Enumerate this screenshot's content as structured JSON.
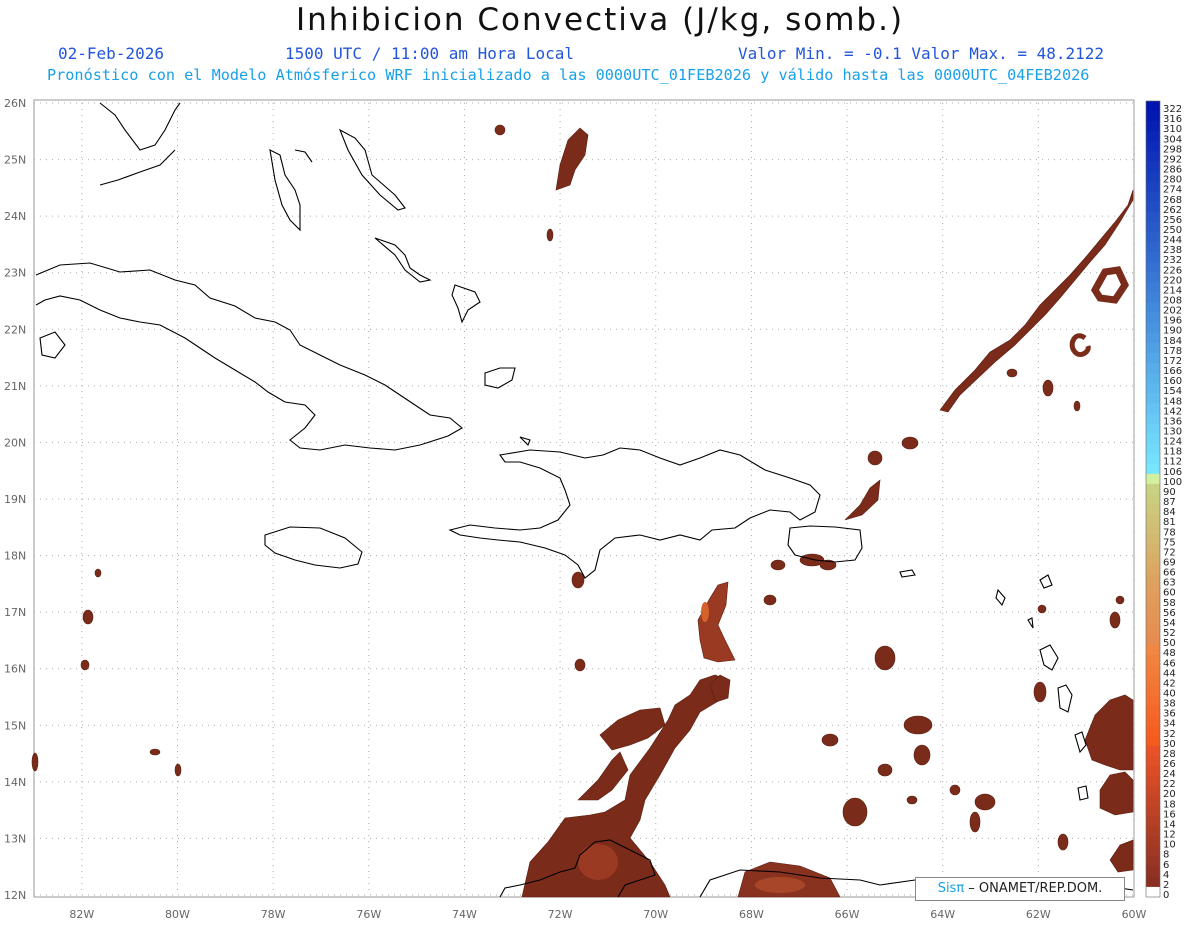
{
  "title": "Inhibicion Convectiva (J/kg, somb.)",
  "header": {
    "date": "02-Feb-2026",
    "time": "1500 UTC / 11:00 am Hora Local",
    "minmax": "Valor Min. = -0.1  Valor Max. = 48.2122",
    "forecast": "Pronóstico con el Modelo Atmósferico WRF inicializado a las 0000UTC_01FEB2026 y válido hasta las  0000UTC_04FEB2026"
  },
  "map": {
    "lon_range": [
      -83,
      -60
    ],
    "lat_range": [
      12,
      26
    ],
    "lat_labels": [
      "26N",
      "25N",
      "24N",
      "23N",
      "22N",
      "21N",
      "20N",
      "19N",
      "18N",
      "17N",
      "16N",
      "15N",
      "14N",
      "13N",
      "12N"
    ],
    "lon_labels": [
      "82W",
      "80W",
      "78W",
      "76W",
      "74W",
      "72W",
      "70W",
      "68W",
      "66W",
      "64W",
      "62W",
      "60W"
    ]
  },
  "colorbar": {
    "labels": [
      "322",
      "316",
      "310",
      "304",
      "298",
      "292",
      "286",
      "280",
      "274",
      "268",
      "262",
      "256",
      "250",
      "244",
      "238",
      "232",
      "226",
      "220",
      "214",
      "208",
      "202",
      "196",
      "190",
      "184",
      "178",
      "172",
      "166",
      "160",
      "154",
      "148",
      "142",
      "136",
      "130",
      "124",
      "118",
      "112",
      "106",
      "100",
      "90",
      "87",
      "84",
      "81",
      "78",
      "75",
      "72",
      "69",
      "66",
      "63",
      "60",
      "58",
      "56",
      "54",
      "52",
      "50",
      "48",
      "46",
      "44",
      "42",
      "40",
      "38",
      "36",
      "34",
      "32",
      "30",
      "28",
      "26",
      "24",
      "22",
      "20",
      "18",
      "16",
      "14",
      "12",
      "10",
      "8",
      "6",
      "4",
      "2",
      "0"
    ]
  },
  "credit": {
    "sis": "Sisπ",
    "org": " – ONAMET/REP.DOM."
  },
  "colors": {
    "fill_dark": "#7a2b1a",
    "fill_mid": "#9a3a22",
    "fill_hot": "#d4622a",
    "coast": "#000000",
    "grid": "#aaaaaa"
  }
}
